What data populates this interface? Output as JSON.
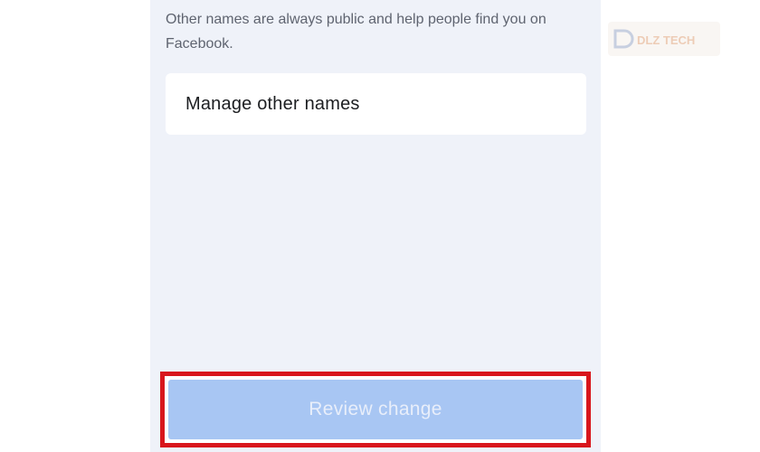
{
  "other_names": {
    "helper_text": "Other names are always public and help people find you on Facebook.",
    "manage_label": "Manage other names"
  },
  "footer": {
    "review_button_label": "Review change",
    "review_button_enabled": false
  },
  "watermark": {
    "text": "DLZ TECH"
  },
  "colors": {
    "screen_background": "#eff2f9",
    "button_disabled": "#a8c6f3",
    "highlight_border": "#d8161c"
  }
}
